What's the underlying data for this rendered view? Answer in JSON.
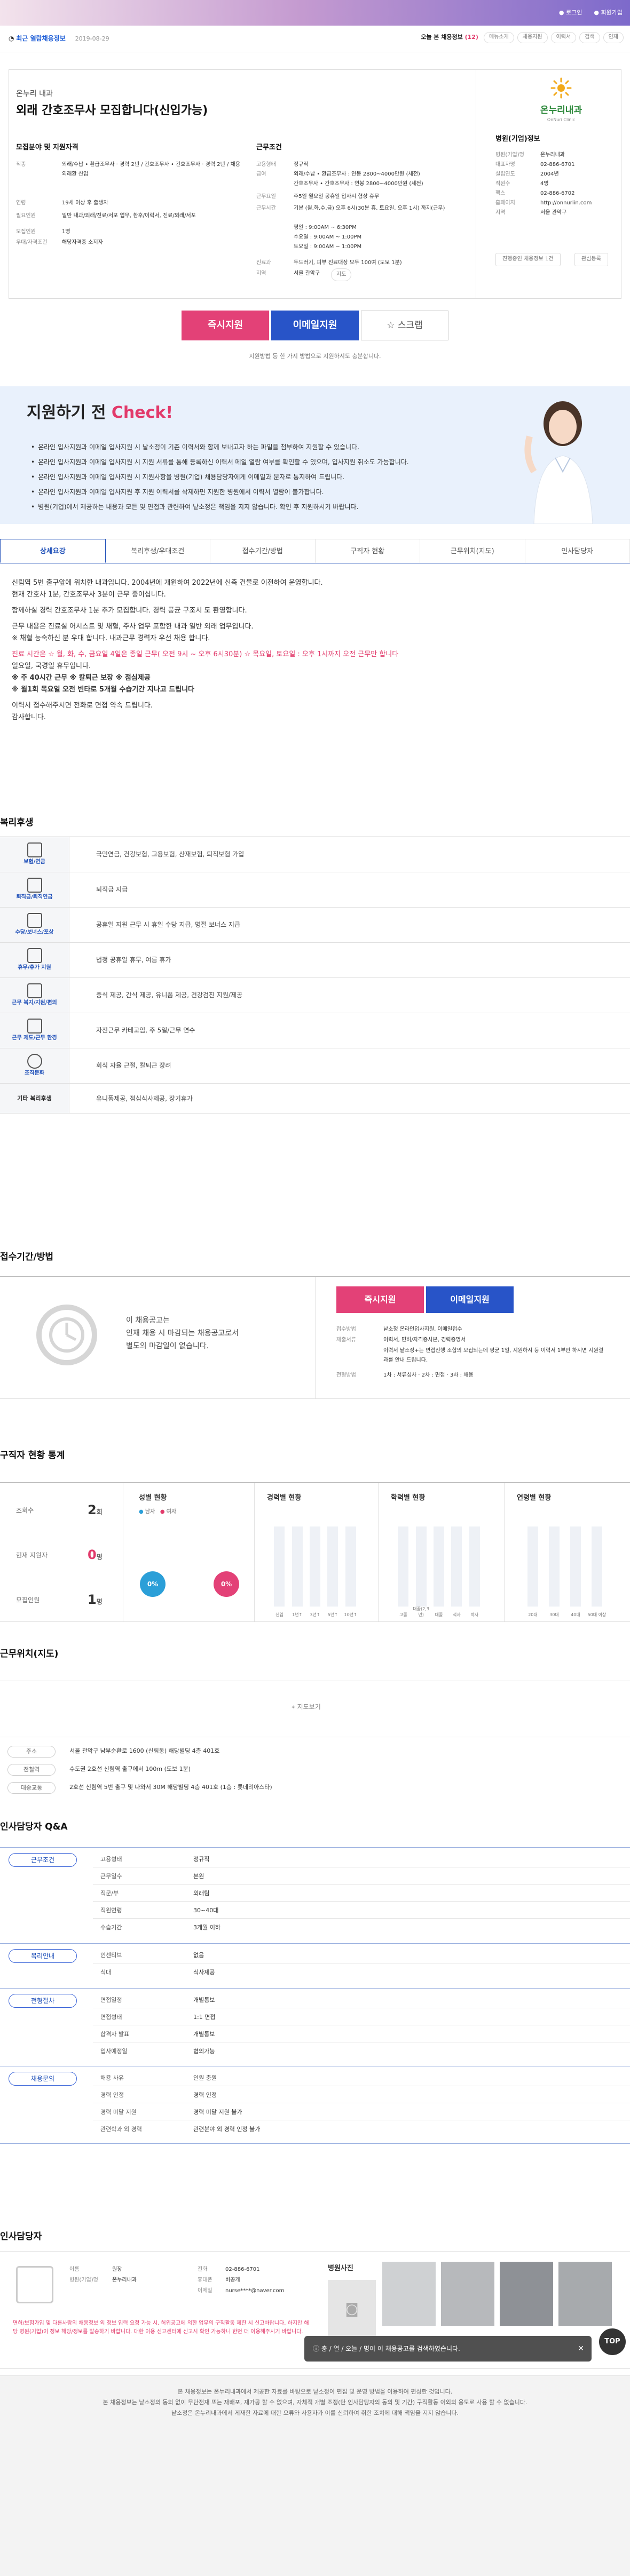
{
  "header": {
    "links": [
      "로그인",
      "회원가입"
    ],
    "recent_label": "최근 열람채용정보",
    "recent_date": "2019-08-29",
    "today_label": "오늘 본 채용정보",
    "today_count": "(12)",
    "chips": [
      "메뉴소개",
      "채용지원",
      "이력서",
      "검색",
      "인재"
    ]
  },
  "job": {
    "clinic": "온누리 내과",
    "title": "외래 간호조무사 모집합니다(신입가능)",
    "requirements_title": "모집분야 및 지원자격",
    "requirements": [
      {
        "k": "직종",
        "v": "외래/수납 • 환급조무사 · 경력 2년 / 간호조무사 • 간호조무사 · 경력 2년 / 채용 외래환 신입"
      },
      {
        "k": "연령",
        "v": "19세 이상 후 출생자"
      },
      {
        "k": "필요인원",
        "v": "일반 내과/외래/진료/서포 업무, 환후/이력서, 진료/외래/서포"
      },
      {
        "k": "모집인원",
        "v": "1명"
      },
      {
        "k": "우대/자격조건",
        "v": "해당자격증 소지자"
      }
    ],
    "conditions_title": "근무조건",
    "conditions": [
      {
        "k": "고용형태",
        "v": "정규직"
      },
      {
        "k": "급여",
        "v": "외래/수납 • 환급조무사 : 연봉 2800~4000만원 (세전)"
      },
      {
        "k": "",
        "v": "간호조무사 • 간호조무사 : 연봉 2800~4000만원 (세전)"
      },
      {
        "k": "근무요일",
        "v": "주5일 월요일 공휴일 입사시 협상 휴무"
      },
      {
        "k": "근무시간",
        "v": "기본 (월,화,수,금) 오후 6시(30분 휴, 토요일, 오후 1시) 까지(근무)"
      },
      {
        "k": "",
        "v": "평일 : 9:00AM ~ 6:30PM"
      },
      {
        "k": "",
        "v": "수요일 : 9:00AM ~ 1:00PM"
      },
      {
        "k": "",
        "v": "토요일 : 9:00AM ~ 1:00PM"
      },
      {
        "k": "진료과",
        "v": "두드러기, 피부 진료대상 모두 100여 (도보 1분)"
      },
      {
        "k": "지역",
        "v": "서울 관악구"
      }
    ],
    "map_chip": "지도"
  },
  "hospital": {
    "logo_name": "온누리내과",
    "logo_sub": "OnNuri Clinic",
    "info_title": "병원(기업)정보",
    "info": [
      {
        "k": "병원(기업)명",
        "v": "온누리내과"
      },
      {
        "k": "대표자명",
        "v": "02-886-6701"
      },
      {
        "k": "설립연도",
        "v": "2004년"
      },
      {
        "k": "직원수",
        "v": "4명"
      },
      {
        "k": "팩스",
        "v": "02-886-6702"
      },
      {
        "k": "홈페이지",
        "v": "http://onnuriin.com"
      },
      {
        "k": "지역",
        "v": "서울 관악구"
      }
    ],
    "btn_more": "진행중인 채용정보 1건",
    "btn_interest": "관심등록"
  },
  "actions": {
    "apply": "즉시지원",
    "email": "이메일지원",
    "scrap": "스크랩"
  },
  "notice": "지원방법 등 한 가지 방법으로 지원하시도 충분합니다.",
  "check": {
    "title_prefix": "지원하기 전 ",
    "title_accent": "Check!",
    "items": [
      "온라인 입사지원과 이메일 입사지원 시 낱소정이 기존 이력서와 함께 보내고자 하는 파일을 첨부하여 지원할 수 있습니다.",
      "온라인 입사지원과 이메일 입사지원 시 지원 서류를 통해 등록하신 이력서 메일 열람 여부를 확인할 수 있으며, 입사지원 취소도 가능합니다.",
      "온라인 입사지원과 이메일 입사지원 시 지원사항을 병원(기업) 채용담당자에게 이메일과 문자로 통지하여 드립니다.",
      "온라인 입사지원과 이메일 입사지원 후 지원 이력서를 삭제하면 지원한 병원에서 이력서 열람이 불가합니다.",
      "병원(기업)에서 제공하는 내용과 모든 및 면접과 관련하여 낱소정은 책임을 지지 않습니다. 확인 후 지원하시기 바랍니다."
    ]
  },
  "tabs": [
    "상세요강",
    "복리후생/우대조건",
    "접수기간/방법",
    "구직자 현황",
    "근무위치(지도)",
    "인사담당자"
  ],
  "detail": [
    "신림역 5번 출구앞에 위치한 내과입니다. 2004년에 개원하여 2022년에 신축 건물로 이전하여 운영합니다.",
    "현재 간호사 1분, 간호조무사 3분이 근무 중이십니다.",
    "함께하실 경력 간호조무사 1분 추가 모집합니다. 경력 풍균 구조시 도 환영합니다.",
    "근무 내용은 진료실 어시스트 및 채혈, 주사 업무 포함한 내과 일반 외래 업무입니다.",
    "※ 채혈 능숙하신 분 우대 합니다. 내과근무 경력자 우선 채용 합니다.",
    "진료 시간은 ☆ 월, 화, 수, 금요일 4일은 종일 근무( 오전 9시 ~ 오후 6시30분) ☆ 목요일, 토요일 : 오후 1시까지 오전 근무만 합니다",
    "일요일, 국경일 휴무입니다.",
    "※ 주 40시간 근무 ※ 칼퇴근 보장 ※ 점심제공",
    "※ 월1회 목요일 오전 빈타로 5개월 수습기간 지나고 드립니다",
    "이력서 접수해주시면 전화로 면접 약속 드립니다.",
    "감사합니다."
  ],
  "welfare": {
    "title": "복리후생",
    "rows": [
      {
        "icon": "shield-icon",
        "label": "보험/연금",
        "value": "국민연금, 건강보험, 고용보험, 산재보험, 퇴직보험 가입"
      },
      {
        "icon": "gift-icon",
        "label": "퇴직금/퇴직연금",
        "value": "퇴직금 지급"
      },
      {
        "icon": "bonus-icon",
        "label": "수당/보너스/포상",
        "value": "공휴일 지원 근무 시 휴일 수당 지급, 명절 보너스 지급"
      },
      {
        "icon": "calendar-icon",
        "label": "휴무/휴가 지원",
        "value": "법정 공휴일 휴무, 여름 휴가"
      },
      {
        "icon": "cup-icon",
        "label": "근무 복지/지원/편의",
        "value": "중식 제공, 간식 제공, 유니폼 제공, 건강검진 지원/제공"
      },
      {
        "icon": "monitor-icon",
        "label": "근무 제도/근무 환경",
        "value": "자전근무 카테고임, 주 5일/근무 연수"
      },
      {
        "icon": "people-icon",
        "label": "조직문화",
        "value": "회식 자율 근절, 칼퇴근 장려"
      },
      {
        "icon": "",
        "label": "기타 복리후생",
        "value": "유니폼제공, 점심식사제공, 장기휴가"
      }
    ]
  },
  "reception": {
    "title": "접수기간/방법",
    "status_msg_1": "이 채용공고는",
    "status_msg_2": "인재 채용 시 마감되는 채용공고로서",
    "status_msg_3": "별도의 마감일이 없습니다.",
    "apply": "즉시지원",
    "email": "이메일지원",
    "rows": [
      {
        "k": "접수방법",
        "v": "낱소정 온라인입사지원, 이메일접수"
      },
      {
        "k": "제출서류",
        "v": "이력서, 면허/자격증사본, 경력증명서"
      },
      {
        "k": "",
        "v": "이력서 낱소정+는 면접진행 조합의 모집되는데 평균 1일, 지원하시 등 이력서 1부만 하시면 지원결과를 안내 드립니다."
      },
      {
        "k": "전형방법",
        "v": "1차 : 서류심사 · 2차 : 면접 · 3차 : 채용"
      }
    ]
  },
  "stats": {
    "title": "구직자 현황 통계",
    "rows": [
      {
        "k": "조회수",
        "v": "2",
        "u": "회"
      },
      {
        "k": "현재 지원자",
        "v": "0",
        "u": "명"
      },
      {
        "k": "모집인원",
        "v": "1",
        "u": "명"
      }
    ],
    "gender_title": "성별 현황",
    "gender_legend": [
      "남자",
      "여자"
    ],
    "gender_values": [
      "0%",
      "0%"
    ],
    "career_title": "경력별 현황",
    "career_labels": [
      "신입",
      "1년↑",
      "3년↑",
      "5년↑",
      "10년↑"
    ],
    "career_values": [
      0,
      0,
      0,
      0,
      0
    ],
    "edu_title": "학력별 현황",
    "edu_labels": [
      "고졸",
      "대졸(2,3년)",
      "대졸",
      "석사",
      "박사"
    ],
    "edu_values": [
      0,
      0,
      0,
      0,
      0
    ],
    "age_title": "연령별 현황",
    "age_labels": [
      "20대",
      "30대",
      "40대",
      "50대 이상"
    ],
    "age_values": [
      0,
      0,
      0,
      0
    ]
  },
  "location": {
    "title": "근무위치(지도)",
    "map_btn": "지도보기",
    "rows": [
      {
        "k": "주소",
        "v": "서울 관악구 남부순환로 1600 (신림동) 해당빌딩 4층 401호"
      },
      {
        "k": "전철역",
        "v": "수도권 2호선 신림역 출구에서 100m (도보 1분)"
      },
      {
        "k": "대중교통",
        "v": "2호선 신림역 5번 출구 및 나와서 30M 해당빌딩 4층 401호 (1층 : 롯데리아스타)"
      }
    ]
  },
  "qa": {
    "title": "인사담당자 Q&A",
    "groups": [
      {
        "tag": "근무조건",
        "items": [
          {
            "q": "고용형태",
            "a": "정규직"
          },
          {
            "q": "근무일수",
            "a": "본원"
          },
          {
            "q": "직군/부",
            "a": "외래팀"
          },
          {
            "q": "직원연령",
            "a": "30~40대"
          },
          {
            "q": "수습기간",
            "a": "3개월 이하"
          }
        ]
      },
      {
        "tag": "복리안내",
        "items": [
          {
            "q": "인센티브",
            "a": "없음"
          },
          {
            "q": "식대",
            "a": "식사제공"
          }
        ]
      },
      {
        "tag": "전형절차",
        "items": [
          {
            "q": "면접일정",
            "a": "개별통보"
          },
          {
            "q": "면접형태",
            "a": "1:1 면접"
          },
          {
            "q": "합격자 발표",
            "a": "개별통보"
          },
          {
            "q": "입사예정일",
            "a": "협의가능"
          }
        ]
      },
      {
        "tag": "채용문의",
        "items": [
          {
            "q": "채용 사유",
            "a": "인원 충원"
          },
          {
            "q": "경력 인정",
            "a": "경력 인정"
          },
          {
            "q": "경력 미달 지원",
            "a": "경력 미달 지원 불가"
          },
          {
            "q": "관련학과 외 경력",
            "a": "관련분야 외 경력 인정 불가"
          }
        ]
      }
    ]
  },
  "contact": {
    "title": "인사담당자",
    "rows_l": [
      {
        "k": "이름",
        "v": "원장"
      },
      {
        "k": "병원(기업)명",
        "v": "온누리내과"
      }
    ],
    "rows_r": [
      {
        "k": "전화",
        "v": "02-886-6701"
      },
      {
        "k": "휴대폰",
        "v": "비공개"
      },
      {
        "k": "이메일",
        "v": "nurse****@naver.com"
      }
    ],
    "warn": "면허/보험가입 및 다른사람의 채용정보 외 정보 입력 요청 가능 시, 허위공고에 의한 업무의 구직활동 제한 시 신고바랍니다. 하지만 해당 병원(기업)이 정보 해당/정보를 발송하기 바랍니다. 대한 이용 신고센터에 신고시 확인 가능하니 한번 더 이용해주시기 바랍니다.",
    "photo_title": "병원사진"
  },
  "footer": {
    "lines": [
      "본 채용정보는 온누리내과에서 제공한 자료를 바탕으로 낱소정이 편집 및 운영 방법을 이용하여 편성한 것입니다.",
      "본 채용정보는 낱소정의 동의 없이 무단전재 또는 재배포, 재가공 할 수 없으며, 자체적 개별 조정(단 인사담당자의 동의 및 기간) 구직활동 이외의 용도로 사용 할 수 없습니다.",
      "낱소정은 온누리내과에서 게재한 자료에 대한 오류와 사용자가 이를 신뢰하여 취한 조치에 대해 책임을 지지 않습니다."
    ]
  },
  "toast": "ⓘ 충 / 열 / 오늘 / 명이 이 채용공고를 검색하였습니다.",
  "top": "TOP"
}
